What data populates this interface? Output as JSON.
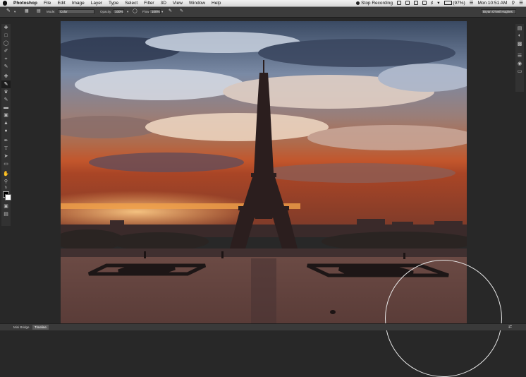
{
  "menubar": {
    "app_name": "Photoshop",
    "menus": [
      "File",
      "Edit",
      "Image",
      "Layer",
      "Type",
      "Select",
      "Filter",
      "3D",
      "View",
      "Window",
      "Help"
    ],
    "recording_label": "Stop Recording",
    "battery": "(97%)",
    "clock": "Mon 10:51 AM"
  },
  "options_bar": {
    "mode_label": "Mode:",
    "mode_value": "Color",
    "opacity_label": "Opacity:",
    "opacity_value": "100%",
    "flow_label": "Flow:",
    "flow_value": "100%",
    "workspace": "Bryan O'Neil Hughes"
  },
  "toolbox": {
    "tools": [
      "move-tool",
      "marquee-tool",
      "lasso-tool",
      "quick-select-tool",
      "crop-tool",
      "eyedropper-tool",
      "healing-tool",
      "brush-tool",
      "clone-stamp-tool",
      "history-brush-tool",
      "eraser-tool",
      "gradient-tool",
      "blur-tool",
      "dodge-tool",
      "pen-tool",
      "type-tool",
      "path-select-tool",
      "shape-tool",
      "hand-tool",
      "zoom-tool"
    ],
    "active_tool": "brush-tool"
  },
  "right_panel": {
    "icons": [
      "history-icon",
      "adjustments-icon",
      "styles-icon",
      "layers-icon",
      "channels-icon",
      "paths-icon"
    ]
  },
  "bottom_tabs": [
    "Mini Bridge",
    "Timeline"
  ],
  "colors": {
    "background": "#282828",
    "foreground_swatch": "#000000",
    "background_swatch": "#ffffff"
  }
}
